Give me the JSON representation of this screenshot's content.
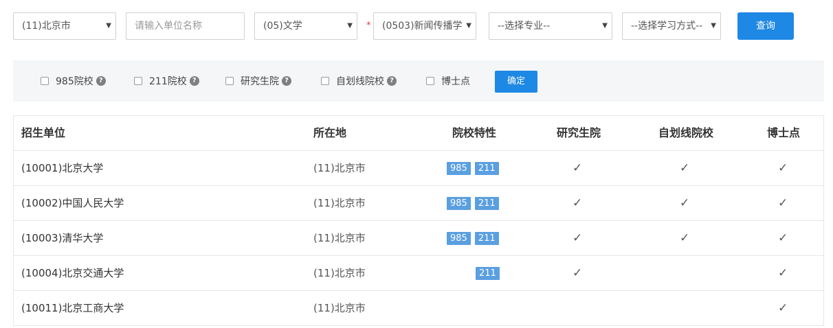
{
  "filters": {
    "province": "(11)北京市",
    "unit_placeholder": "请输入单位名称",
    "category": "(05)文学",
    "required_mark": "*",
    "discipline": "(0503)新闻传播学",
    "major": "--选择专业--",
    "study_mode": "--选择学习方式--",
    "query_label": "查询",
    "caret": "▼"
  },
  "checkbar": {
    "items": [
      {
        "label": "985院校",
        "help": true
      },
      {
        "label": "211院校",
        "help": true
      },
      {
        "label": "研究生院",
        "help": true
      },
      {
        "label": "自划线院校",
        "help": true
      },
      {
        "label": "博士点",
        "help": false
      }
    ],
    "help_glyph": "?",
    "confirm_label": "确定"
  },
  "table": {
    "headers": {
      "name": "招生单位",
      "location": "所在地",
      "features": "院校特性",
      "grad_school": "研究生院",
      "self_line": "自划线院校",
      "phd": "博士点"
    },
    "check_glyph": "✓",
    "rows": [
      {
        "name": "(10001)北京大学",
        "location": "(11)北京市",
        "tag985": "985",
        "tag211": "211",
        "grad_school": true,
        "self_line": true,
        "phd": true
      },
      {
        "name": "(10002)中国人民大学",
        "location": "(11)北京市",
        "tag985": "985",
        "tag211": "211",
        "grad_school": true,
        "self_line": true,
        "phd": true
      },
      {
        "name": "(10003)清华大学",
        "location": "(11)北京市",
        "tag985": "985",
        "tag211": "211",
        "grad_school": true,
        "self_line": true,
        "phd": true
      },
      {
        "name": "(10004)北京交通大学",
        "location": "(11)北京市",
        "tag985": "",
        "tag211": "211",
        "grad_school": true,
        "self_line": false,
        "phd": true
      },
      {
        "name": "(10011)北京工商大学",
        "location": "(11)北京市",
        "tag985": "",
        "tag211": "",
        "grad_school": false,
        "self_line": false,
        "phd": true
      }
    ]
  }
}
